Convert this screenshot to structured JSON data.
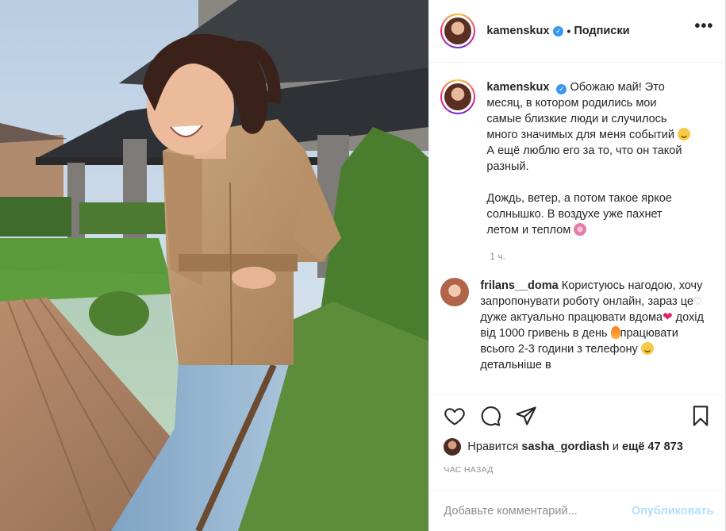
{
  "post": {
    "username": "kamenskux",
    "follow_label": "Подписки",
    "dot": "•",
    "more_label": "•••"
  },
  "caption": {
    "username": "kamenskux",
    "line1": "Обожаю май! Это месяц, в котором родились мои самые близкие люди и случилось много значимых для меня событий",
    "line2": "А ещё люблю его за то, что он такой разный.",
    "line3": "Дождь, ветер, а потом такое яркое солнышко. В воздухе уже пахнет летом и теплом",
    "time": "1 ч."
  },
  "comment": {
    "username": "frilans__doma",
    "part1": "Користуюсь нагодою, хочу запропонувати роботу онлайн, зараз це дуже актуально працювати вдома",
    "part2": "дохід від 1000 гривень в день",
    "part3": "працювати всього 2-3 години з телефону",
    "part4": "детальніше в"
  },
  "likes": {
    "prefix": "Нравится",
    "user": "sasha_gordiash",
    "mid": "и",
    "count": "ещё 47 873"
  },
  "ago": "час назад",
  "add_comment": {
    "placeholder": "Добавьте комментарий...",
    "publish_label": "Опубликовать"
  },
  "icons": {
    "verified": "verified-badge-icon",
    "like": "heart-icon",
    "comment": "comment-bubble-icon",
    "share": "paper-plane-icon",
    "save": "bookmark-icon"
  },
  "colors": {
    "accent": "#3897f0",
    "publish_disabled": "#b2dffc",
    "muted": "#8e8e8e",
    "border": "#efefef"
  }
}
